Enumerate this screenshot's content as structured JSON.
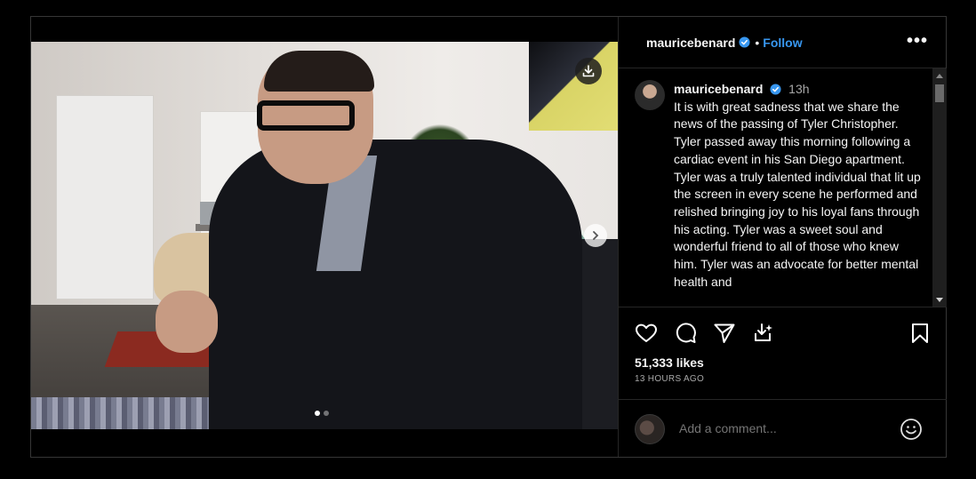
{
  "post": {
    "username": "mauricebenard",
    "follow_label": "Follow",
    "separator": "•",
    "more_label": "•••"
  },
  "caption": {
    "username": "mauricebenard",
    "time": "13h",
    "text": "It is with great sadness that we share the news of the passing of Tyler Christopher. Tyler passed away this morning following a cardiac event in his San Diego apartment. Tyler was a truly talented individual that lit up the screen in every scene he performed and relished bringing joy to his loyal fans through his acting. Tyler was a sweet soul and wonderful friend to all of those who knew him. Tyler was an advocate for better mental health and"
  },
  "stats": {
    "likes": "51,333 likes",
    "time_ago": "13 HOURS AGO"
  },
  "comment": {
    "placeholder": "Add a comment..."
  },
  "carousel": {
    "total": 2,
    "active_index": 0
  },
  "icons": {
    "download": "download-icon",
    "next": "chevron-right-icon",
    "like": "heart-icon",
    "comment": "comment-icon",
    "share": "send-icon",
    "save_media": "download-tray-icon",
    "bookmark": "bookmark-icon",
    "emoji": "emoji-icon",
    "verified": "verified-badge-icon"
  },
  "colors": {
    "background": "#000000",
    "accent": "#3897f0",
    "muted_text": "#a8a8a8",
    "border": "#262626"
  }
}
